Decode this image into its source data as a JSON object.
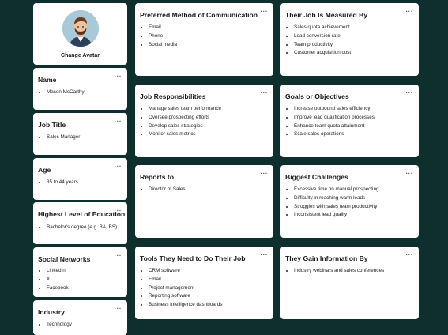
{
  "avatar": {
    "change_label": "Change Avatar"
  },
  "more_glyph": "···",
  "left_cards": [
    {
      "title": "Name",
      "items": [
        "Mason McCarthy"
      ]
    },
    {
      "title": "Job Title",
      "items": [
        "Sales Manager"
      ]
    },
    {
      "title": "Age",
      "items": [
        "35 to 44 years"
      ]
    },
    {
      "title": "Highest Level of Education",
      "items": [
        "Bachelor's degree (e.g. BA, BS)"
      ]
    },
    {
      "title": "Social Networks",
      "items": [
        "LinkedIn",
        "X",
        "Facebook"
      ]
    },
    {
      "title": "Industry",
      "items": [
        "Technology"
      ]
    }
  ],
  "cards": [
    {
      "title": "Preferred Method of Communication",
      "items": [
        "Email",
        "Phone",
        "Social media"
      ]
    },
    {
      "title": "Their Job Is Measured By",
      "items": [
        "Sales quota achievement",
        "Lead conversion rate",
        "Team productivity",
        "Customer acquisition cost"
      ]
    },
    {
      "title": "Job Responsibilities",
      "items": [
        "Manage sales team performance",
        "Oversee prospecting efforts",
        "Develop sales strategies",
        "Monitor sales metrics"
      ]
    },
    {
      "title": "Goals or Objectives",
      "items": [
        "Increase outbound sales efficiency",
        "Improve lead qualification processes",
        "Enhance team quota attainment",
        "Scale sales operations"
      ]
    },
    {
      "title": "Reports to",
      "items": [
        "Director of Sales"
      ]
    },
    {
      "title": "Biggest Challenges",
      "items": [
        "Excessive time on manual prospecting",
        "Difficulty in reaching warm leads",
        "Struggles with sales team productivity",
        "Inconsistent lead quality"
      ]
    },
    {
      "title": "Tools They Need to Do Their Job",
      "items": [
        "CRM software",
        "Email",
        "Project management",
        "Reporting software",
        "Business intelligence dashboards"
      ]
    },
    {
      "title": "They Gain Information By",
      "items": [
        "Industry webinars and sales conferences"
      ]
    }
  ]
}
